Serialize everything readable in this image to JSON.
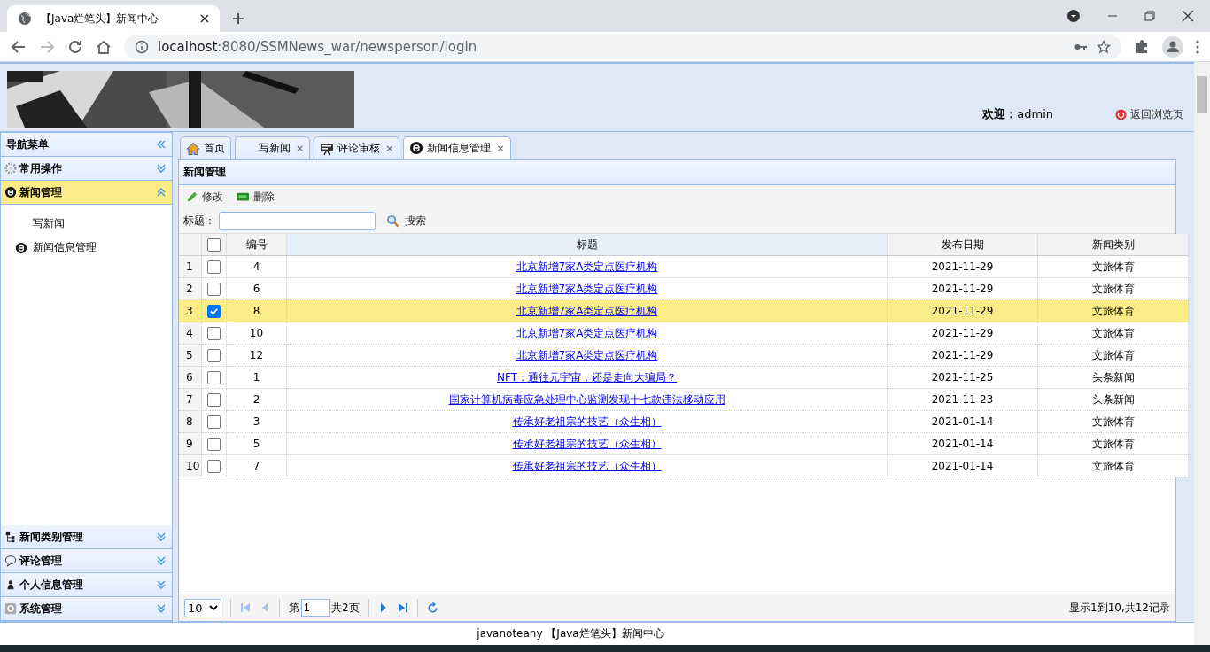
{
  "browser": {
    "tab_title": "【Java烂笔头】新闻中心",
    "url_host": "localhost",
    "url_path": ":8080/SSMNews_war/newsperson/login"
  },
  "header": {
    "welcome_label": "欢迎：",
    "user": "admin",
    "back_link": "返回浏览页"
  },
  "sidebar": {
    "title": "导航菜单",
    "sections": [
      {
        "label": "常用操作",
        "expanded": false
      },
      {
        "label": "新闻管理",
        "expanded": true,
        "children": [
          {
            "label": "写新闻"
          },
          {
            "label": "新闻信息管理"
          }
        ]
      },
      {
        "label": "新闻类别管理",
        "expanded": false
      },
      {
        "label": "评论管理",
        "expanded": false
      },
      {
        "label": "个人信息管理",
        "expanded": false
      },
      {
        "label": "系统管理",
        "expanded": false
      }
    ]
  },
  "tabs": [
    {
      "label": "首页",
      "selected": false
    },
    {
      "label": "写新闻",
      "close": "×",
      "selected": false
    },
    {
      "label": "评论审核",
      "close": "×",
      "selected": false
    },
    {
      "label": "新闻信息管理",
      "close": "×",
      "selected": true
    }
  ],
  "panel": {
    "title": "新闻管理",
    "toolbar": [
      {
        "label": "修改"
      },
      {
        "label": "删除"
      }
    ],
    "search": {
      "label": "标题：",
      "button": "搜索"
    },
    "all_checked": false,
    "columns": [
      "编号",
      "标题",
      "发布日期",
      "新闻类别"
    ],
    "rows": [
      {
        "num": "1",
        "selected": false,
        "id": "4",
        "title": "北京新增7家A类定点医疗机构",
        "date": "2021-11-29",
        "category": "文旅体育"
      },
      {
        "num": "2",
        "selected": false,
        "id": "6",
        "title": "北京新增7家A类定点医疗机构",
        "date": "2021-11-29",
        "category": "文旅体育"
      },
      {
        "num": "3",
        "selected": true,
        "id": "8",
        "title": "北京新增7家A类定点医疗机构",
        "date": "2021-11-29",
        "category": "文旅体育"
      },
      {
        "num": "4",
        "selected": false,
        "id": "10",
        "title": "北京新增7家A类定点医疗机构",
        "date": "2021-11-29",
        "category": "文旅体育"
      },
      {
        "num": "5",
        "selected": false,
        "id": "12",
        "title": "北京新增7家A类定点医疗机构",
        "date": "2021-11-29",
        "category": "文旅体育"
      },
      {
        "num": "6",
        "selected": false,
        "id": "1",
        "title": "NFT：通往元宇宙，还是走向大骗局？",
        "date": "2021-11-25",
        "category": "头条新闻"
      },
      {
        "num": "7",
        "selected": false,
        "id": "2",
        "title": "国家计算机病毒应急处理中心监测发现十七款违法移动应用",
        "date": "2021-11-23",
        "category": "头条新闻"
      },
      {
        "num": "8",
        "selected": false,
        "id": "3",
        "title": "传承好老祖宗的技艺（众生相）",
        "date": "2021-01-14",
        "category": "文旅体育"
      },
      {
        "num": "9",
        "selected": false,
        "id": "5",
        "title": "传承好老祖宗的技艺（众生相）",
        "date": "2021-01-14",
        "category": "文旅体育"
      },
      {
        "num": "10",
        "selected": false,
        "id": "7",
        "title": "传承好老祖宗的技艺（众生相）",
        "date": "2021-01-14",
        "category": "文旅体育"
      }
    ],
    "pager": {
      "page_size": "10",
      "page_prefix": "第",
      "page": "1",
      "page_total": "共2页",
      "summary": "显示1到10,共12记录"
    }
  },
  "footer": "javanoteany 【Java烂笔头】新闻中心"
}
